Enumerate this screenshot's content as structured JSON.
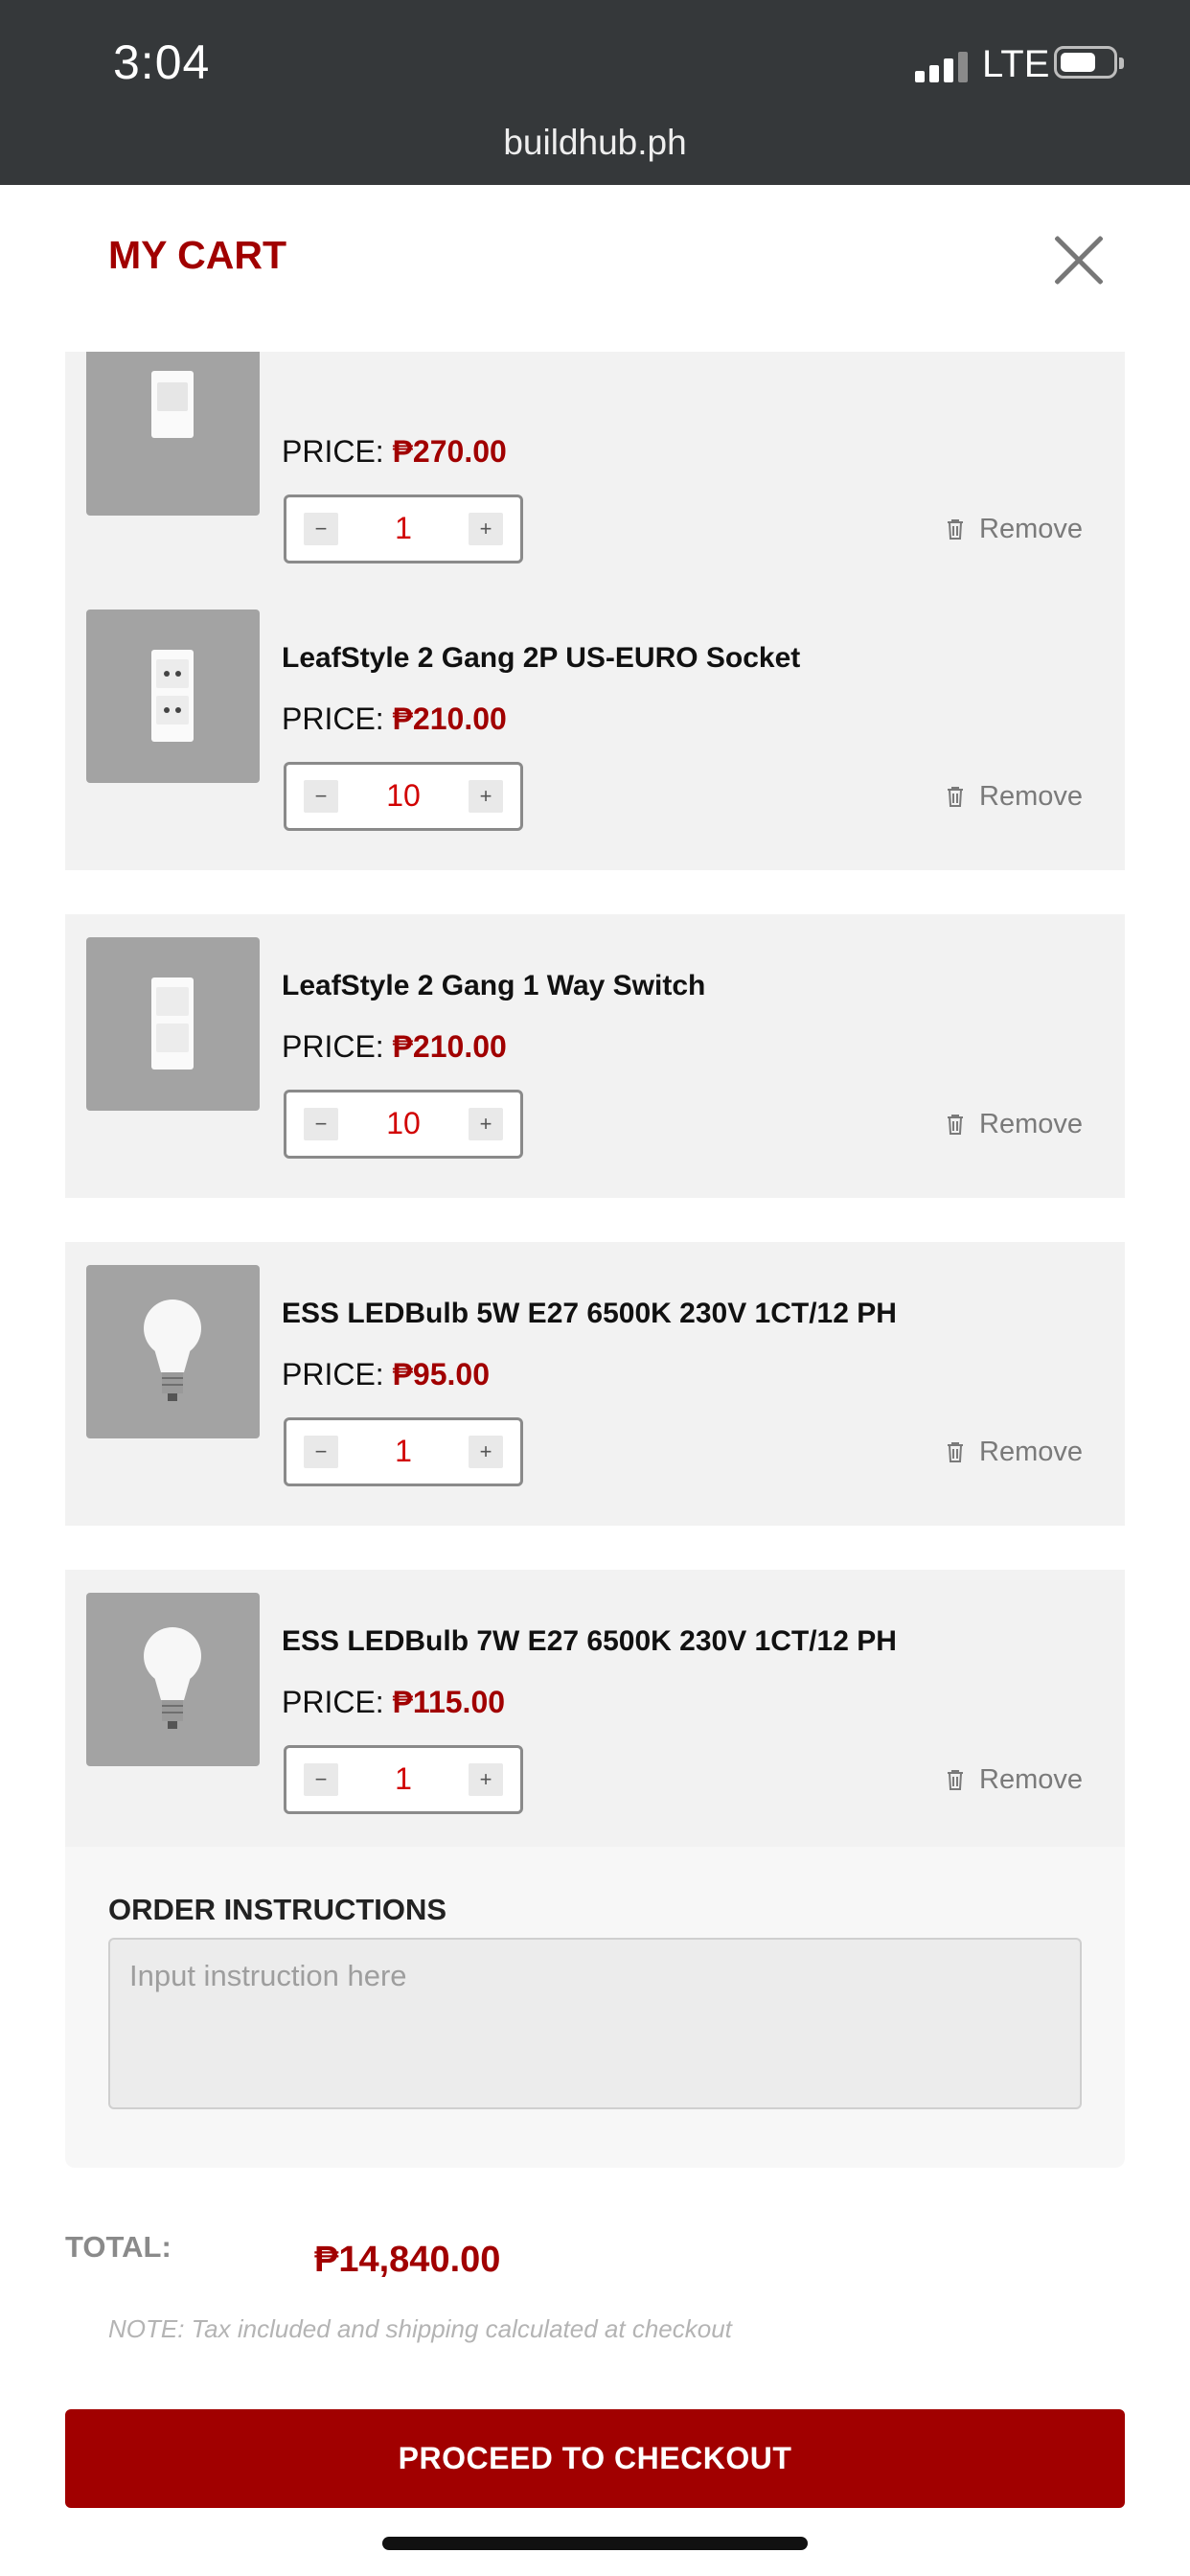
{
  "status_bar": {
    "time": "3:04",
    "network": "LTE",
    "url": "buildhub.ph"
  },
  "header": {
    "title": "MY CART"
  },
  "cart": {
    "price_label": "PRICE:",
    "remove_label": "Remove",
    "minus": "−",
    "plus": "+",
    "items": [
      {
        "name": "",
        "price": "₱270.00",
        "qty": "1",
        "product": "single-switch"
      },
      {
        "name": "LeafStyle 2 Gang 2P US-EURO Socket",
        "price": "₱210.00",
        "qty": "10",
        "product": "socket"
      },
      {
        "name": "LeafStyle 2 Gang 1 Way Switch",
        "price": "₱210.00",
        "qty": "10",
        "product": "double-switch"
      },
      {
        "name": "ESS LEDBulb 5W E27 6500K 230V 1CT/12 PH",
        "price": "₱95.00",
        "qty": "1",
        "product": "bulb"
      },
      {
        "name": "ESS LEDBulb 7W E27 6500K 230V 1CT/12 PH",
        "price": "₱115.00",
        "qty": "1",
        "product": "bulb"
      }
    ]
  },
  "order_instructions": {
    "label": "ORDER INSTRUCTIONS",
    "placeholder": "Input instruction here",
    "value": ""
  },
  "totals": {
    "label": "TOTAL:",
    "value": "₱14,840.00",
    "note": "NOTE: Tax included and shipping calculated at checkout"
  },
  "checkout_button": "PROCEED TO CHECKOUT",
  "colors": {
    "accent": "#a10000",
    "qty_text": "#d10000",
    "status_bar": "#35383a",
    "item_bg": "#f2f2f2"
  }
}
